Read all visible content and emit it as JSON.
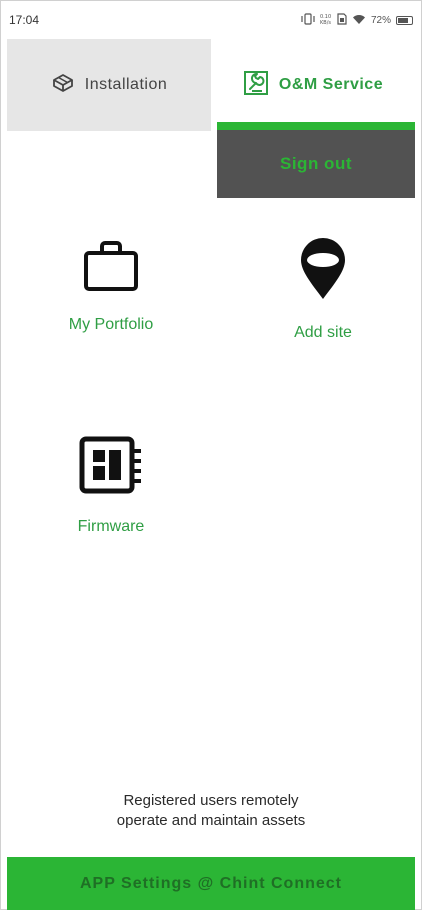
{
  "status_bar": {
    "time": "17:04",
    "battery": "72%",
    "icons": [
      "vibrate-icon",
      "network-speed-icon",
      "sim-icon",
      "wifi-icon",
      "battery-icon"
    ]
  },
  "tabs": [
    {
      "label": "Installation",
      "icon": "package-box-icon",
      "active": false
    },
    {
      "label": "O&M Service",
      "icon": "wrench-service-icon",
      "active": true
    }
  ],
  "sign_out_label": "Sign out",
  "tiles": [
    {
      "label": "My Portfolio",
      "icon": "briefcase-icon"
    },
    {
      "label": "Add site",
      "icon": "map-pin-icon"
    },
    {
      "label": "Firmware",
      "icon": "chip-icon"
    }
  ],
  "footer": {
    "line1": "Registered users remotely",
    "line2": "operate and maintain assets"
  },
  "bottom_bar_label": "APP Settings @ Chint Connect",
  "colors": {
    "accent_green": "#2bb535",
    "label_green": "#2f9e44",
    "signout_bg": "#525252",
    "inactive_tab_bg": "#e6e6e6"
  }
}
